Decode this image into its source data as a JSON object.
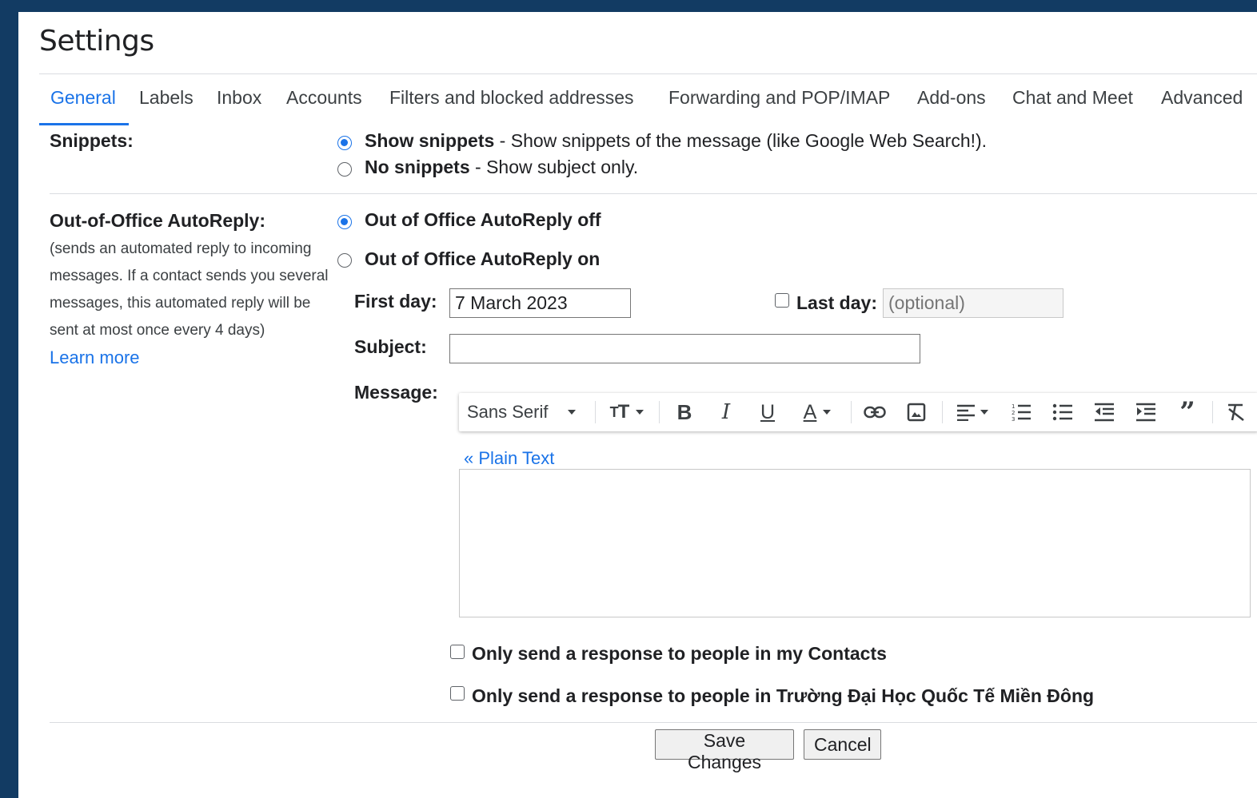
{
  "page": {
    "title": "Settings"
  },
  "tabs": [
    {
      "label": "General",
      "active": true
    },
    {
      "label": "Labels"
    },
    {
      "label": "Inbox"
    },
    {
      "label": "Accounts"
    },
    {
      "label": "Filters and blocked addresses"
    },
    {
      "label": "Forwarding and POP/IMAP"
    },
    {
      "label": "Add-ons"
    },
    {
      "label": "Chat and Meet"
    },
    {
      "label": "Advanced"
    }
  ],
  "snippets": {
    "label": "Snippets:",
    "options": [
      {
        "title": "Show snippets",
        "desc": " - Show snippets of the message (like Google Web Search!).",
        "selected": true
      },
      {
        "title": "No snippets",
        "desc": " - Show subject only.",
        "selected": false
      }
    ]
  },
  "autoreply": {
    "label": "Out-of-Office AutoReply:",
    "description": "(sends an automated reply to incoming messages. If a contact sends you several messages, this automated reply will be sent at most once every 4 days)",
    "learn_more": "Learn more",
    "options": [
      {
        "title": "Out of Office AutoReply off",
        "selected": true
      },
      {
        "title": "Out of Office AutoReply on",
        "selected": false
      }
    ],
    "first_day_label": "First day:",
    "first_day_value": "7 March 2023",
    "last_day_label": "Last day:",
    "last_day_placeholder": "(optional)",
    "subject_label": "Subject:",
    "subject_value": "",
    "message_label": "Message:",
    "plain_text_link": "« Plain Text",
    "contacts_only": "Only send a response to people in my Contacts",
    "org_only": "Only send a response to people in Trường Đại Học Quốc Tế Miền Đông"
  },
  "toolbar": {
    "font": "Sans Serif",
    "icons": [
      "font-size-icon",
      "bold-icon",
      "italic-icon",
      "underline-icon",
      "text-color-icon",
      "link-icon",
      "image-icon",
      "align-icon",
      "numbered-list-icon",
      "bulleted-list-icon",
      "indent-less-icon",
      "indent-more-icon",
      "quote-icon",
      "remove-formatting-icon"
    ]
  },
  "buttons": {
    "save": "Save Changes",
    "cancel": "Cancel"
  },
  "colors": {
    "accent": "#1a73e8",
    "frame": "#123b63"
  }
}
